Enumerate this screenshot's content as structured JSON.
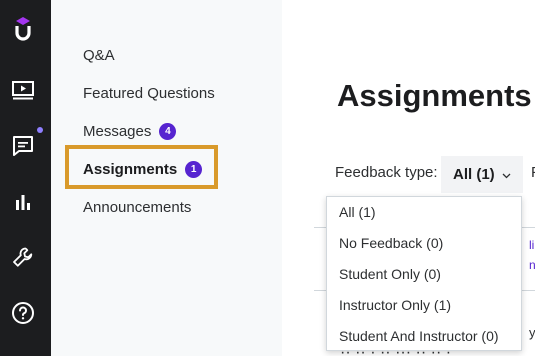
{
  "rail": {
    "icons": [
      "udemy-logo-icon",
      "video-icon",
      "chat-icon",
      "bar-chart-icon",
      "wrench-icon",
      "help-icon"
    ],
    "notification_color": "#8f7fff"
  },
  "subnav": {
    "items": [
      {
        "label": "Q&A"
      },
      {
        "label": "Featured Questions"
      },
      {
        "label": "Messages",
        "badge": "4"
      },
      {
        "label": "Assignments",
        "badge": "1"
      },
      {
        "label": "Announcements"
      }
    ],
    "active_item": "Assignments"
  },
  "main": {
    "title": "Assignments",
    "filter_label": "Feedback type:",
    "filter_value": "All (1)",
    "clipped_next_filter_letter": "F"
  },
  "dropdown": {
    "options": [
      "All (1)",
      "No Feedback (0)",
      "Student Only (0)",
      "Instructor Only (1)",
      "Student And Instructor (0)"
    ]
  },
  "colors": {
    "rail_bg": "#1c1d1f",
    "subnav_bg": "#f7f9fa",
    "badge": "#5624d0",
    "highlight": "#d99a2b"
  }
}
